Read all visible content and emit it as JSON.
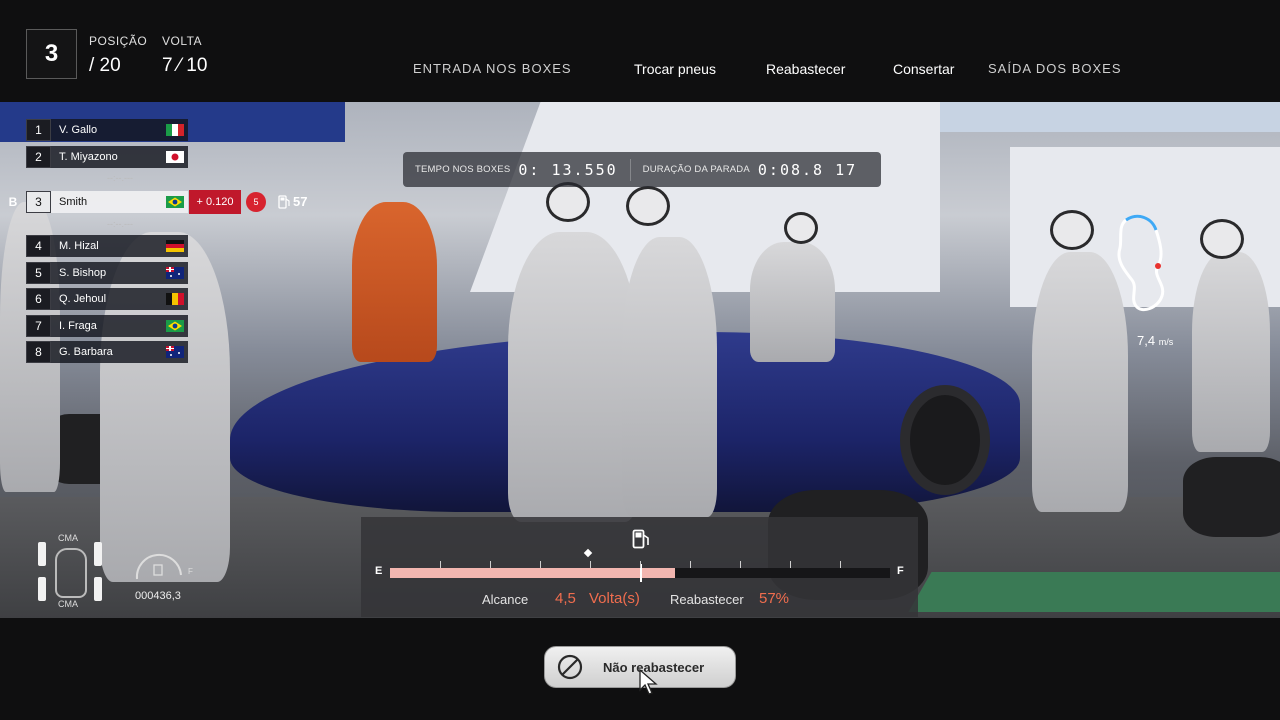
{
  "header": {
    "position_current": "3",
    "position_label": "POSIÇÃO",
    "position_total": "/ 20",
    "lap_label": "VOLTA",
    "lap_value": "7 ⁄ 10"
  },
  "pit_steps": [
    {
      "label": "ENTRADA NOS BOXES",
      "active": false
    },
    {
      "label": "Trocar pneus",
      "active": true
    },
    {
      "label": "Reabastecer",
      "active": true
    },
    {
      "label": "Consertar",
      "active": true
    },
    {
      "label": "SAÍDA DOS BOXES",
      "active": false
    }
  ],
  "pit_timer": {
    "time_in_pits_label": "TEMPO NOS BOXES",
    "time_in_pits_value": "0: 13.550",
    "stop_duration_label": "DURAÇÃO DA PARADA",
    "stop_duration_value": "0:08.8 17"
  },
  "standings": {
    "rows": [
      {
        "pos": "1",
        "name": "V. Gallo",
        "flag": "italy",
        "marker": ""
      },
      {
        "pos": "2",
        "name": "T. Miyazono",
        "flag": "japan",
        "marker": ""
      },
      {
        "pos": "3",
        "name": "Smith",
        "flag": "brazil",
        "marker": "B",
        "player": true
      },
      {
        "pos": "4",
        "name": "M. Hizal",
        "flag": "germany",
        "marker": ""
      },
      {
        "pos": "5",
        "name": "S. Bishop",
        "flag": "australia",
        "marker": ""
      },
      {
        "pos": "6",
        "name": "Q. Jehoul",
        "flag": "belgium",
        "marker": ""
      },
      {
        "pos": "7",
        "name": "I. Fraga",
        "flag": "brazil",
        "marker": ""
      },
      {
        "pos": "8",
        "name": "G. Barbara",
        "flag": "australia",
        "marker": ""
      }
    ],
    "gap_placeholder": "--:--.---",
    "player_diff": "+ 0.120",
    "penalty_value": "5",
    "fuel_laps": "57"
  },
  "speed": {
    "value": "7,4",
    "unit": "m/s"
  },
  "car_status": {
    "cma_top": "CMA",
    "cma_bottom": "CMA",
    "gauge_letter": "F",
    "odometer": "000436,3"
  },
  "fuel": {
    "empty_label": "E",
    "full_label": "F",
    "fill_fraction": 0.57,
    "current_fraction": 0.5,
    "marker_fraction": 0.39,
    "range_label": "Alcance",
    "range_value": "4,5",
    "range_unit": "Volta(s)",
    "refuel_label": "Reabastecer",
    "refuel_value": "57%"
  },
  "actions": {
    "no_refuel_label": "Não reabastecer"
  },
  "colors": {
    "accent_orange": "#f06d4e",
    "penalty_red": "#c0182b",
    "fuel_fill": "#f2b6b0"
  }
}
